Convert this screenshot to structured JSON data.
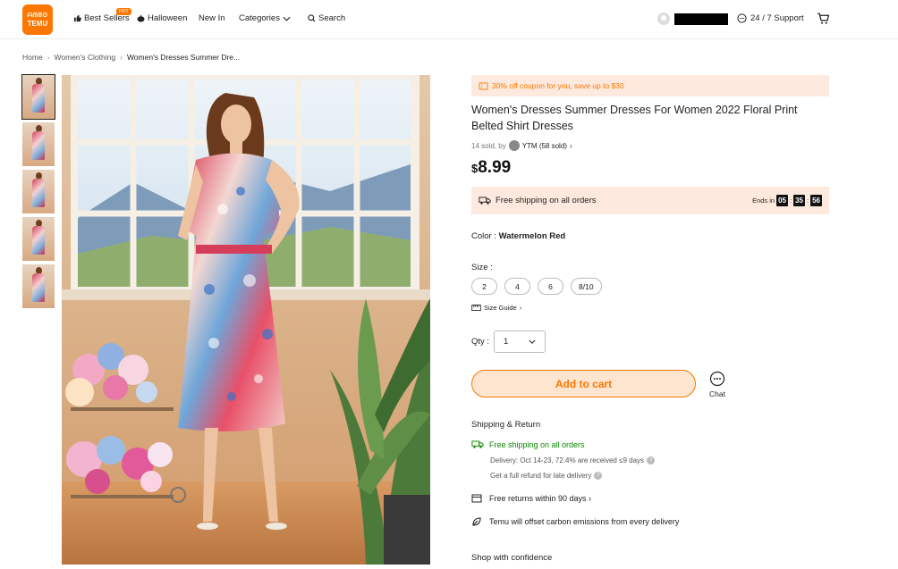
{
  "header": {
    "logo_line1": "ᗩᗰᘔO",
    "logo_line2": "TEMU",
    "nav": [
      {
        "label": "Best Sellers",
        "icon": "thumbs-up-icon"
      },
      {
        "label": "Halloween",
        "icon": "pumpkin-icon"
      },
      {
        "label": "New In"
      },
      {
        "label": "Categories",
        "icon": "chevron-down-icon"
      },
      {
        "label": "Search",
        "icon": "search-icon"
      }
    ],
    "hot_badge": "HOT",
    "support": "24 / 7 Support"
  },
  "breadcrumb": {
    "items": [
      "Home",
      "Women's Clothing",
      "Women's Dresses Summer Dre..."
    ],
    "separator": "›"
  },
  "product": {
    "coupon": "30% off coupon for you, save up to $30",
    "title": "Women's Dresses Summer Dresses For Women 2022 Floral Print Belted Shirt Dresses",
    "sold_prefix": "14 sold, by",
    "store": "YTM (58 sold)",
    "store_chevron": "›",
    "currency": "$",
    "price": "8.99",
    "shipping_bar": "Free shipping on all orders",
    "ends_in": "Ends in",
    "countdown": [
      "05",
      "35",
      "56"
    ],
    "countdown_sep": ":",
    "color_label": "Color : ",
    "color_value": "Watermelon Red",
    "size_label": "Size :",
    "sizes": [
      "2",
      "4",
      "6",
      "8/10"
    ],
    "size_guide": "Size Guide",
    "size_guide_chevron": "›",
    "qty_label": "Qty :",
    "qty_value": "1",
    "add_to_cart": "Add to cart",
    "chat": "Chat"
  },
  "shipping_return": {
    "title": "Shipping & Return",
    "free_shipping": "Free shipping on all orders",
    "delivery": "Delivery: Oct 14-23, 72.4% are received ≤9 days",
    "refund": "Get a full refund for late delivery",
    "returns": "Free returns within 90 days ›",
    "carbon": "Temu will offset carbon emissions from every delivery"
  },
  "confidence": {
    "title": "Shop with confidence"
  },
  "colors": {
    "accent": "#fb7701",
    "accent_light": "#fde9dd",
    "green": "#0a8a00"
  }
}
